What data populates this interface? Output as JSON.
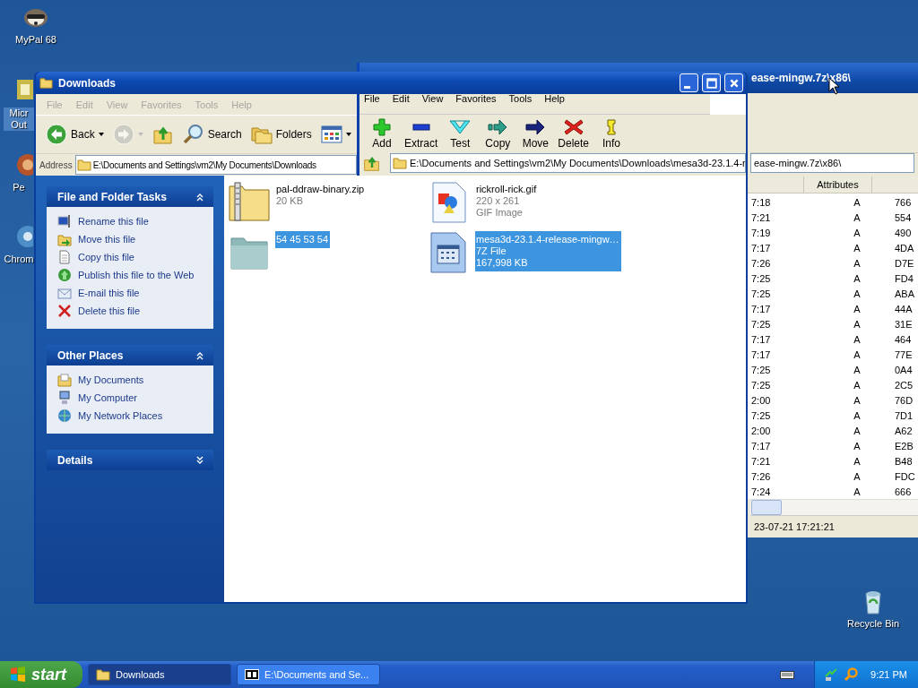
{
  "desktop_icons": [
    {
      "label": "MyPal 68",
      "kind": "animal",
      "selected": false
    },
    {
      "label": "Micr Out",
      "kind": "mail",
      "selected": true
    },
    {
      "label": "Pe",
      "kind": "round",
      "selected": false
    },
    {
      "label": "Chrom",
      "kind": "globe",
      "selected": false
    },
    {
      "label": "Recycle Bin",
      "kind": "bin",
      "selected": false
    }
  ],
  "archive_window": {
    "title": "ease-mingw.7z\\x86\\",
    "address": "ease-mingw.7z\\x86\\",
    "columns": [
      "Attributes"
    ],
    "rows": [
      {
        "column_1": "7:18",
        "attributes": "A",
        "column_3": "766"
      },
      {
        "column_1": "7:21",
        "attributes": "A",
        "column_3": "554"
      },
      {
        "column_1": "7:19",
        "attributes": "A",
        "column_3": "490"
      },
      {
        "column_1": "7:17",
        "attributes": "A",
        "column_3": "4DA"
      },
      {
        "column_1": "7:26",
        "attributes": "A",
        "column_3": "D7E"
      },
      {
        "column_1": "7:25",
        "attributes": "A",
        "column_3": "FD4"
      },
      {
        "column_1": "7:25",
        "attributes": "A",
        "column_3": "ABA"
      },
      {
        "column_1": "7:17",
        "attributes": "A",
        "column_3": "44A"
      },
      {
        "column_1": "7:25",
        "attributes": "A",
        "column_3": "31E"
      },
      {
        "column_1": "7:17",
        "attributes": "A",
        "column_3": "464"
      },
      {
        "column_1": "7:17",
        "attributes": "A",
        "column_3": "77E"
      },
      {
        "column_1": "7:25",
        "attributes": "A",
        "column_3": "0A4"
      },
      {
        "column_1": "7:25",
        "attributes": "A",
        "column_3": "2C5"
      },
      {
        "column_1": "2:00",
        "attributes": "A",
        "column_3": "76D"
      },
      {
        "column_1": "7:25",
        "attributes": "A",
        "column_3": "7D1"
      },
      {
        "column_1": "2:00",
        "attributes": "A",
        "column_3": "A62"
      },
      {
        "column_1": "7:17",
        "attributes": "A",
        "column_3": "E2B"
      },
      {
        "column_1": "7:21",
        "attributes": "A",
        "column_3": "B48"
      },
      {
        "column_1": "7:26",
        "attributes": "A",
        "column_3": "FDC"
      },
      {
        "column_1": "7:24",
        "attributes": "A",
        "column_3": "666"
      }
    ],
    "status": "23-07-21 17:21:21"
  },
  "explorer": {
    "title": "Downloads",
    "menu": [
      {
        "label": "File",
        "disabled": true
      },
      {
        "label": "Edit",
        "disabled": true
      },
      {
        "label": "View",
        "disabled": true
      },
      {
        "label": "Favorites",
        "disabled": true
      },
      {
        "label": "Tools",
        "disabled": true
      },
      {
        "label": "Help",
        "disabled": true
      }
    ],
    "toolbar": [
      {
        "kind": "back",
        "label": "Back",
        "disabled": false
      },
      {
        "kind": "forward",
        "disabled": true
      },
      {
        "kind": "up",
        "disabled": false
      },
      {
        "kind": "search",
        "label": "Search",
        "disabled": false
      },
      {
        "kind": "folders",
        "label": "Folders",
        "disabled": false
      },
      {
        "kind": "views",
        "disabled": false
      }
    ],
    "address_label": "Address",
    "address": "E:\\Documents and Settings\\vm2\\My Documents\\Downloads",
    "archive_menu": [
      "File",
      "Edit",
      "View",
      "Favorites",
      "Tools",
      "Help"
    ],
    "archive_toolbar": [
      {
        "kind": "add",
        "label": "Add"
      },
      {
        "kind": "extract",
        "label": "Extract"
      },
      {
        "kind": "test",
        "label": "Test"
      },
      {
        "kind": "copy",
        "label": "Copy"
      },
      {
        "kind": "move",
        "label": "Move"
      },
      {
        "kind": "delete",
        "label": "Delete"
      },
      {
        "kind": "info",
        "label": "Info"
      }
    ],
    "archive_address": "E:\\Documents and Settings\\vm2\\My Documents\\Downloads\\mesa3d-23.1.4-r",
    "panels": [
      {
        "title": "File and Folder Tasks",
        "expanded": true,
        "items": [
          {
            "kind": "rename",
            "label": "Rename this file"
          },
          {
            "kind": "move",
            "label": "Move this file"
          },
          {
            "kind": "copy",
            "label": "Copy this file"
          },
          {
            "kind": "publish",
            "label": "Publish this file to the Web"
          },
          {
            "kind": "email",
            "label": "E-mail this file"
          },
          {
            "kind": "delete",
            "label": "Delete this file"
          }
        ]
      },
      {
        "title": "Other Places",
        "expanded": true,
        "items": [
          {
            "kind": "documents",
            "label": "My Documents"
          },
          {
            "kind": "computer",
            "label": "My Computer"
          },
          {
            "kind": "network",
            "label": "My Network Places"
          }
        ]
      },
      {
        "title": "Details",
        "expanded": false
      }
    ],
    "files": [
      {
        "kind": "zip",
        "name": "pal-ddraw-binary.zip",
        "details": [
          "20 KB"
        ],
        "selected": false
      },
      {
        "kind": "image",
        "name": "rickroll-rick.gif",
        "details": [
          "220 x 261",
          "GIF Image"
        ],
        "selected": false
      },
      {
        "kind": "folder",
        "name": "54 45 53 54",
        "selected": true
      },
      {
        "kind": "archive",
        "name": "mesa3d-23.1.4-release-mingw…",
        "details": [
          "7Z File",
          "167,998 KB"
        ],
        "selected": true
      }
    ]
  },
  "taskbar": {
    "start": "start",
    "tasks": [
      {
        "kind": "folder",
        "label": "Downloads",
        "selected": true
      },
      {
        "kind": "archive",
        "label": "E:\\Documents and Se...",
        "selected": false
      }
    ],
    "clock": "9:21 PM"
  }
}
